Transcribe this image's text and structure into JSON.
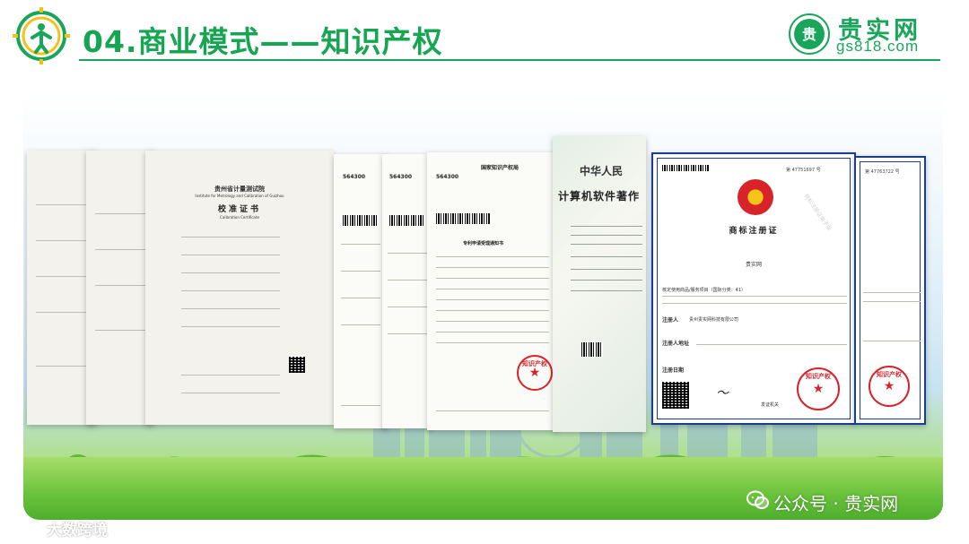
{
  "header": {
    "title": "04.商业模式——知识产权",
    "brand_name": "贵实网",
    "brand_url": "gs818.com"
  },
  "calibration_certs": {
    "issuer": "贵州省计量测试院",
    "issuer_en": "Institute for Metrology and Calibration of Guizhou",
    "title": "校准证书",
    "title_en": "Calibration Certificate"
  },
  "patent_docs": {
    "postcode": "564300",
    "office": "国家知识产权局",
    "notice_title": "专利申请受理通知书",
    "stamp_text": "知识产权"
  },
  "software_cert": {
    "title_line1": "中华人民",
    "title_line2": "计算机软件著作"
  },
  "trademark_cert": {
    "number1": "第 47751697 号",
    "number2": "第 47763722 号",
    "title": "商标注册证",
    "mark": "贵实网",
    "goods_label": "核定使用商品/服务项目（国际分类：41）",
    "registrant_label": "注册人",
    "registrant": "贵州贵实网科技有限公司",
    "address_label": "注册人地址",
    "date_label": "注册日期",
    "issuer": "发证机关",
    "stamp_text": "知识产权",
    "watermark": "商标注册证电子版"
  },
  "footer": {
    "left_watermark": "大数跨境",
    "right_watermark": "公众号 · 贵实网"
  },
  "colors": {
    "primary_green": "#16a552",
    "stamp_red": "#d8232a",
    "trademark_blue": "#1a3d8f"
  }
}
